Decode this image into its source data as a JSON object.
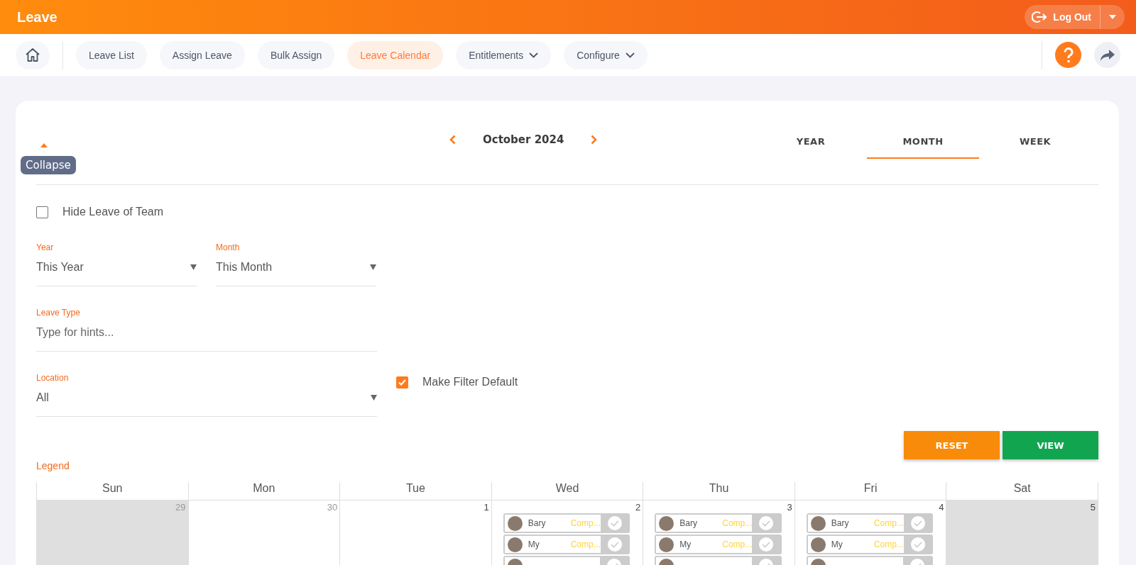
{
  "header": {
    "title": "Leave",
    "logout": "Log Out"
  },
  "nav": {
    "items": [
      {
        "label": "Leave List",
        "selected": false,
        "dropdown": false
      },
      {
        "label": "Assign Leave",
        "selected": false,
        "dropdown": false
      },
      {
        "label": "Bulk Assign",
        "selected": false,
        "dropdown": false
      },
      {
        "label": "Leave Calendar",
        "selected": true,
        "dropdown": false
      },
      {
        "label": "Entitlements",
        "selected": false,
        "dropdown": true
      },
      {
        "label": "Configure",
        "selected": false,
        "dropdown": true
      }
    ]
  },
  "calendar": {
    "collapse_tooltip": "Collapse",
    "period": "October 2024",
    "views": [
      {
        "label": "YEAR",
        "selected": false
      },
      {
        "label": "MONTH",
        "selected": true
      },
      {
        "label": "WEEK",
        "selected": false
      }
    ],
    "filters": {
      "hide_team": {
        "label": "Hide Leave of Team",
        "checked": false
      },
      "year": {
        "label": "Year",
        "value": "This Year"
      },
      "month": {
        "label": "Month",
        "value": "This Month"
      },
      "leave_type": {
        "label": "Leave Type",
        "placeholder": "Type for hints..."
      },
      "location": {
        "label": "Location",
        "value": "All"
      },
      "make_default": {
        "label": "Make Filter Default",
        "checked": true
      }
    },
    "buttons": [
      {
        "label": "RESET",
        "kind": "reset"
      },
      {
        "label": "VIEW",
        "kind": "view"
      }
    ],
    "legend": "Legend",
    "weekdays": [
      "Sun",
      "Mon",
      "Tue",
      "Wed",
      "Thu",
      "Fri",
      "Sat"
    ],
    "days": [
      {
        "number": "29",
        "other_month": true,
        "weekend": true
      },
      {
        "number": "30",
        "other_month": true,
        "weekend": false
      },
      {
        "number": "1",
        "other_month": false,
        "weekend": false
      },
      {
        "number": "2",
        "other_month": false,
        "weekend": false,
        "leaves": [
          {
            "kind": "entry",
            "name": "Bary",
            "type": "Comp..."
          },
          {
            "kind": "entry",
            "name": "My",
            "type": "Comp..."
          },
          {
            "kind": "cut"
          }
        ]
      },
      {
        "number": "3",
        "other_month": false,
        "weekend": false,
        "leaves": [
          {
            "kind": "entry",
            "name": "Bary",
            "type": "Comp..."
          },
          {
            "kind": "entry",
            "name": "My",
            "type": "Comp..."
          },
          {
            "kind": "cut"
          }
        ]
      },
      {
        "number": "4",
        "other_month": false,
        "weekend": false,
        "leaves": [
          {
            "kind": "entry",
            "name": "Bary",
            "type": "Comp..."
          },
          {
            "kind": "entry",
            "name": "My",
            "type": "Comp..."
          },
          {
            "kind": "cut"
          }
        ]
      },
      {
        "number": "5",
        "other_month": false,
        "weekend": true
      }
    ]
  }
}
